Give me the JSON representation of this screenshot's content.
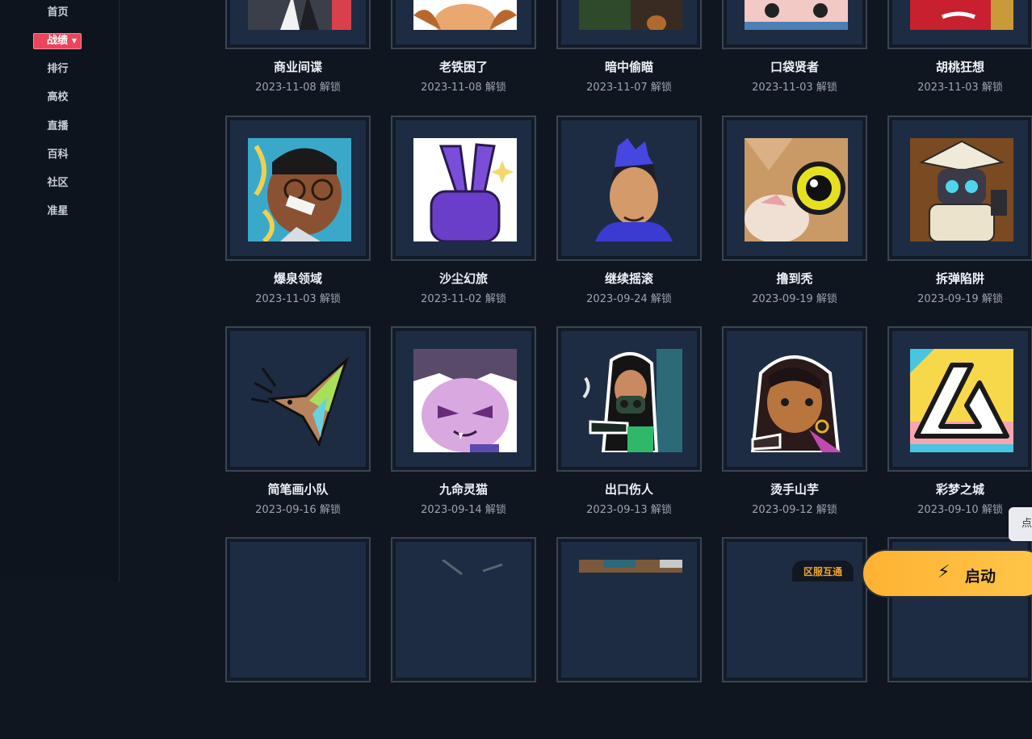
{
  "sidebar": {
    "items": [
      "首页",
      "战绩",
      "排行",
      "高校",
      "直播",
      "百科",
      "社区",
      "准星"
    ],
    "active": "战绩"
  },
  "cards": [
    {
      "title": "商业间谍",
      "date": "2023-11-08 解锁"
    },
    {
      "title": "老铁困了",
      "date": "2023-11-08 解锁"
    },
    {
      "title": "暗中偷瞄",
      "date": "2023-11-07 解锁"
    },
    {
      "title": "口袋贤者",
      "date": "2023-11-03 解锁"
    },
    {
      "title": "胡桃狂想",
      "date": "2023-11-03 解锁"
    },
    {
      "title": "爆泉领域",
      "date": "2023-11-03 解锁"
    },
    {
      "title": "沙尘幻旅",
      "date": "2023-11-02 解锁"
    },
    {
      "title": "继续摇滚",
      "date": "2023-09-24 解锁"
    },
    {
      "title": "撸到秃",
      "date": "2023-09-19 解锁"
    },
    {
      "title": "拆弹陷阱",
      "date": "2023-09-19 解锁"
    },
    {
      "title": "简笔画小队",
      "date": "2023-09-16 解锁"
    },
    {
      "title": "九命灵猫",
      "date": "2023-09-14 解锁"
    },
    {
      "title": "出口伤人",
      "date": "2023-09-13 解锁"
    },
    {
      "title": "烫手山芋",
      "date": "2023-09-12 解锁"
    },
    {
      "title": "彩梦之城",
      "date": "2023-09-10 解锁"
    },
    {
      "title": "",
      "date": ""
    },
    {
      "title": "",
      "date": ""
    },
    {
      "title": "",
      "date": ""
    },
    {
      "title": "",
      "date": ""
    },
    {
      "title": "",
      "date": ""
    }
  ],
  "footer": {
    "region_badge": "区服互通",
    "launch_label": "启动",
    "side_button": "点"
  }
}
